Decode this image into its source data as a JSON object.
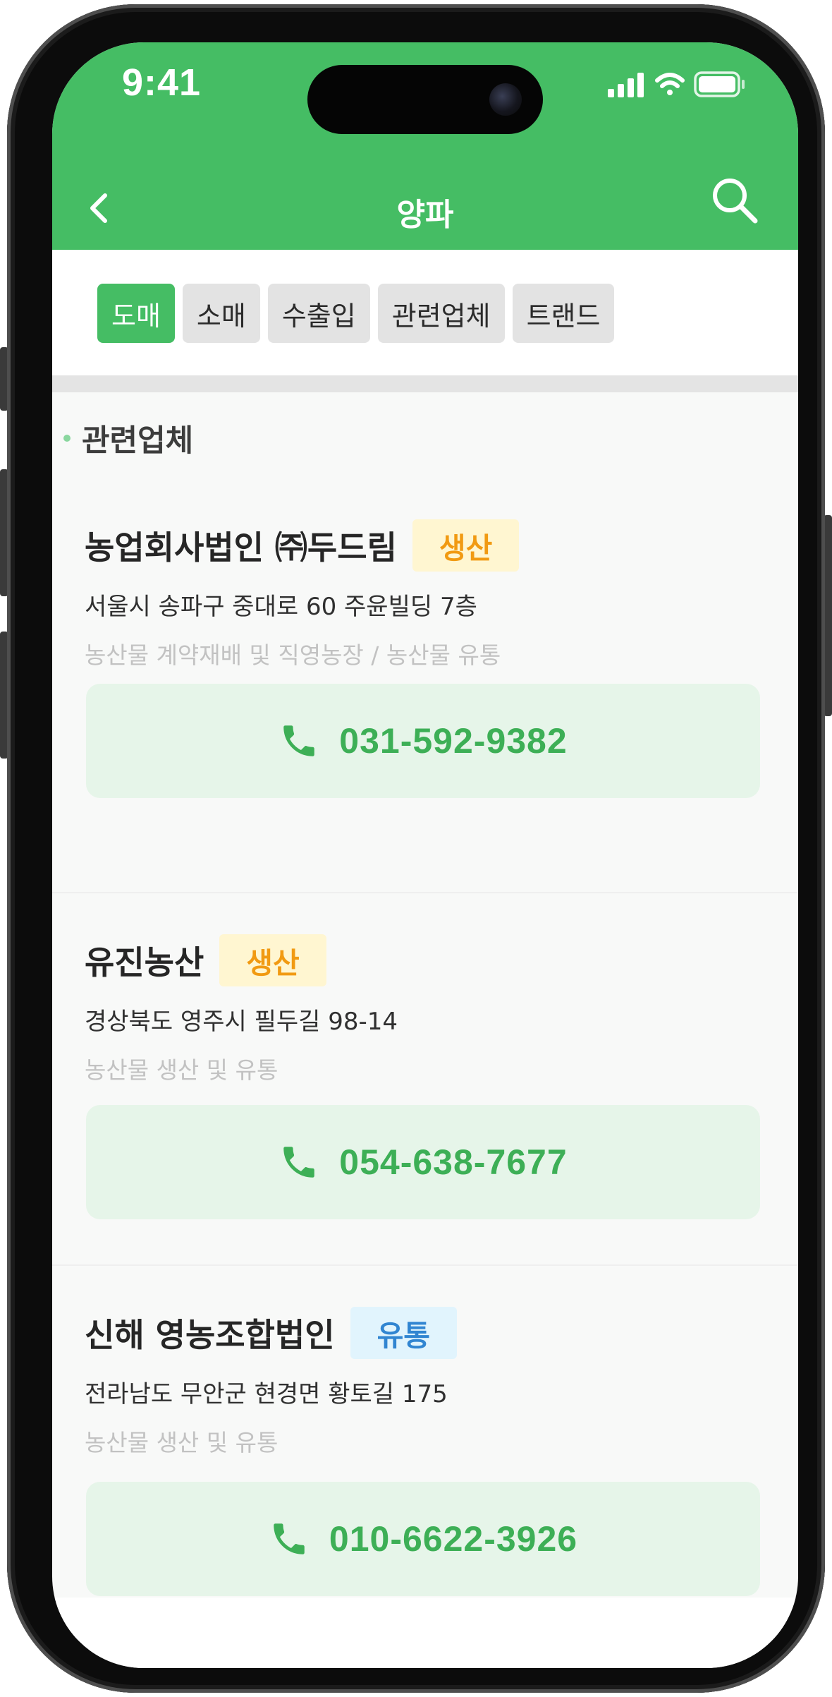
{
  "status_bar": {
    "time": "9:41"
  },
  "header": {
    "title": "양파"
  },
  "tabs": [
    {
      "label": "도매",
      "active": true
    },
    {
      "label": "소매",
      "active": false
    },
    {
      "label": "수출입",
      "active": false
    },
    {
      "label": "관련업체",
      "active": false
    },
    {
      "label": "트랜드",
      "active": false
    }
  ],
  "section": {
    "title": "관련업체"
  },
  "companies": [
    {
      "name": "농업회사법인 ㈜두드림",
      "badge": "생산",
      "address": "서울시 송파구 중대로 60 주윤빌딩 7층",
      "description": "농산물 계약재배 및 직영농장 / 농산물 유통",
      "phone": "031-592-9382"
    },
    {
      "name": "유진농산",
      "badge": "생산",
      "address": "경상북도 영주시 필두길 98-14",
      "description": "농산물 생산 및 유통",
      "phone": "054-638-7677"
    },
    {
      "name": "신해 영농조합법인",
      "badge": "유통",
      "address": "전라남도 무안군 현경면 황토길 175",
      "description": "농산물 생산 및 유통",
      "phone": "010-6622-3926"
    }
  ],
  "colors": {
    "brand_green": "#45bd64",
    "badge_produce": "#f19a12",
    "badge_distribution": "#3185d1"
  }
}
